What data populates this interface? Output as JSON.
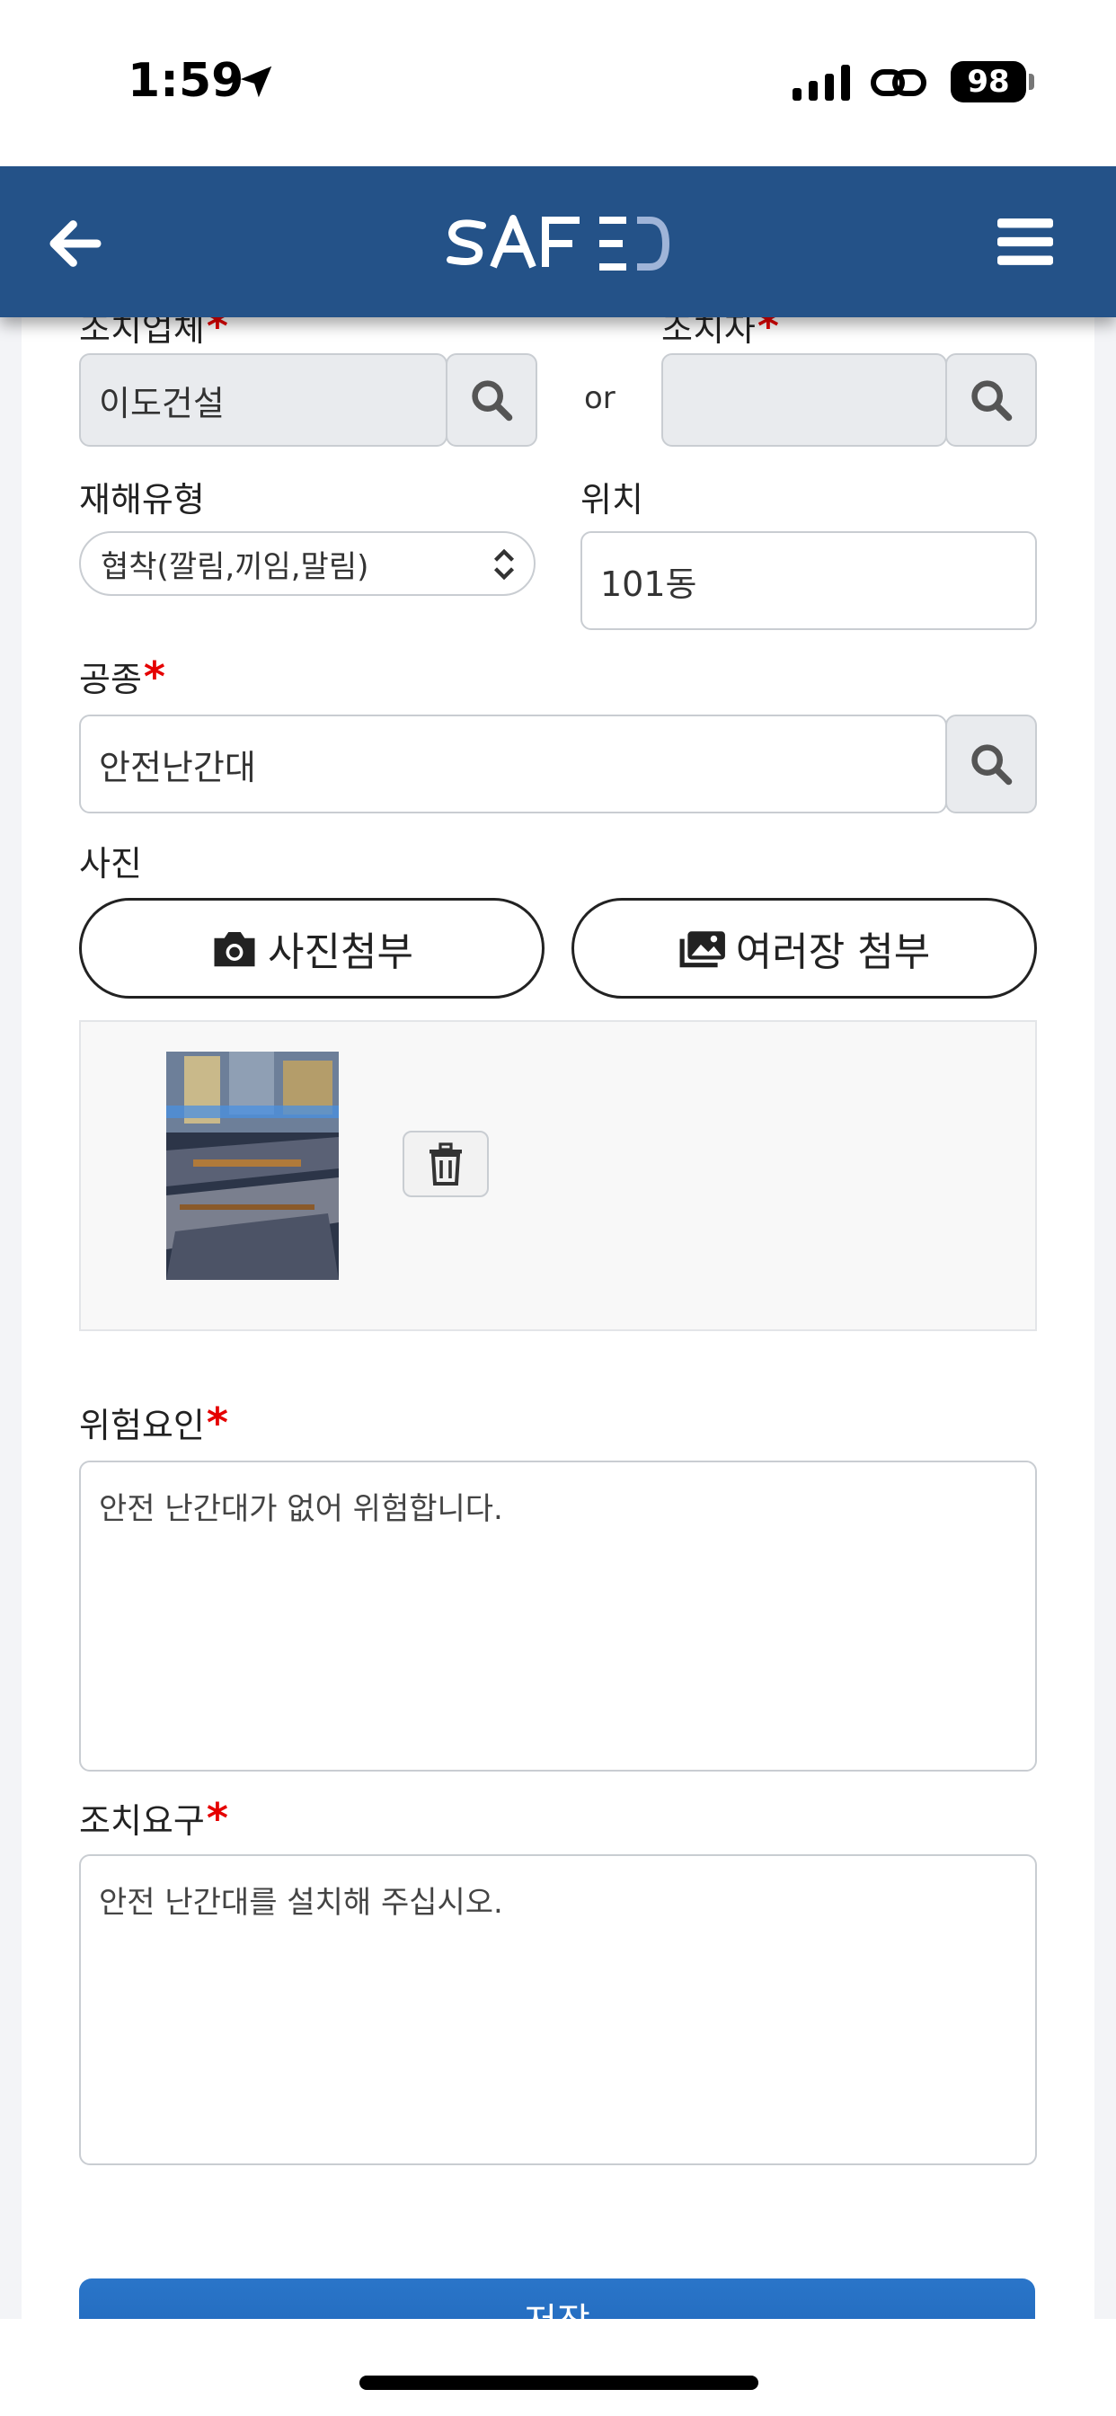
{
  "status_bar": {
    "time": "1:59",
    "battery": "98"
  },
  "header": {
    "logo_text": "SAFED"
  },
  "form": {
    "company": {
      "label": "조치업체",
      "value": "이도건설"
    },
    "or_text": "or",
    "person": {
      "label": "조치자",
      "value": ""
    },
    "accident_type": {
      "label": "재해유형",
      "selected": "협착(깔림,끼임,말림)"
    },
    "location": {
      "label": "위치",
      "value": "101동"
    },
    "work_type": {
      "label": "공종",
      "value": "안전난간대"
    },
    "photo": {
      "label": "사진",
      "attach_label": "사진첨부",
      "multi_attach_label": "여러장 첨부"
    },
    "risk_factor": {
      "label": "위험요인",
      "value": "안전 난간대가 없어 위험합니다."
    },
    "action_request": {
      "label": "조치요구",
      "value": "안전 난간대를 설치해 주십시오."
    },
    "required_mark": "*",
    "submit_label": "저장"
  },
  "colors": {
    "header": "#245288",
    "required": "#e50000",
    "submit": "#2a75c9"
  }
}
